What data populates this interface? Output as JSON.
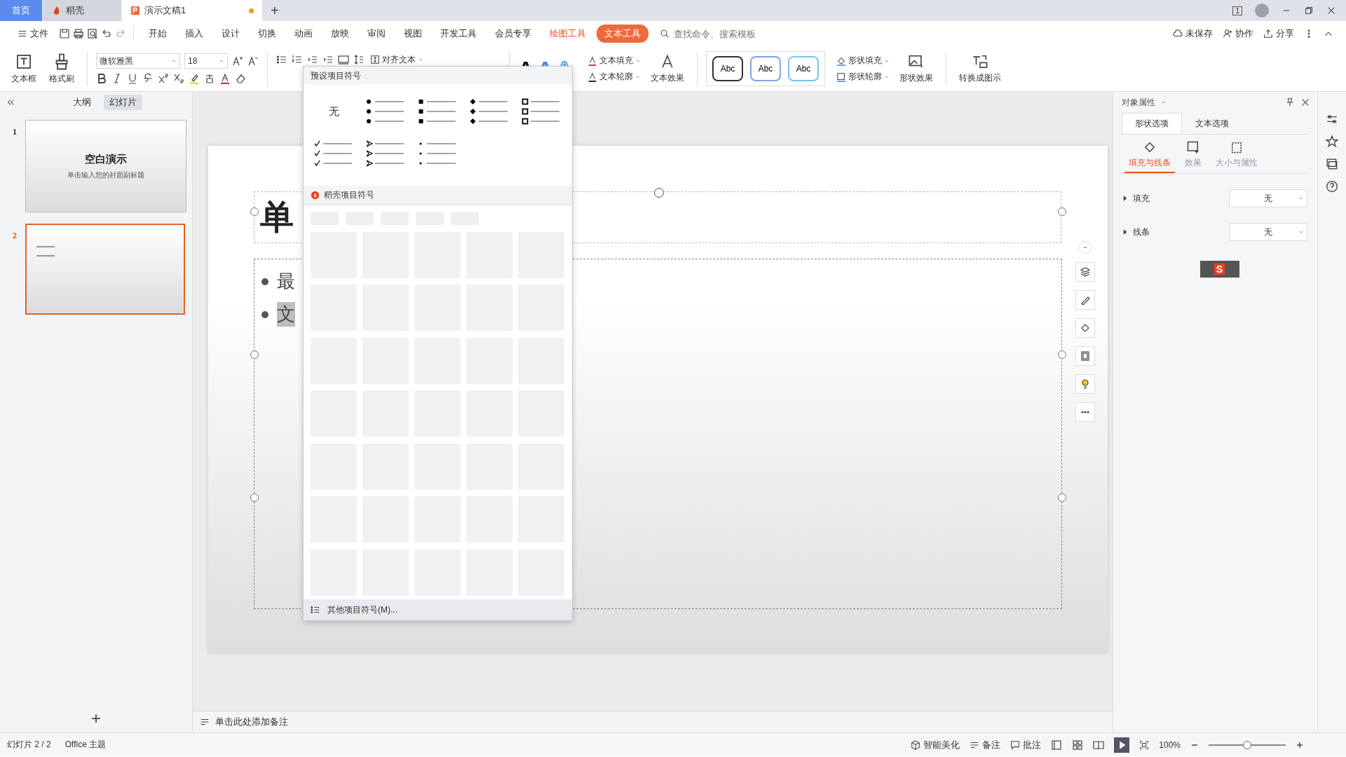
{
  "tabs": [
    {
      "label": "首页",
      "kind": "home",
      "selected": false
    },
    {
      "label": "稻壳",
      "kind": "docer",
      "selected": false
    },
    {
      "label": "演示文稿1",
      "kind": "doc",
      "selected": true,
      "unsaved": true
    }
  ],
  "new_tab": "+",
  "window_count": "1",
  "menu": {
    "file": "文件",
    "items": [
      {
        "label": "开始",
        "kind": "plain"
      },
      {
        "label": "插入",
        "kind": "plain"
      },
      {
        "label": "设计",
        "kind": "plain"
      },
      {
        "label": "切换",
        "kind": "plain"
      },
      {
        "label": "动画",
        "kind": "plain"
      },
      {
        "label": "放映",
        "kind": "plain"
      },
      {
        "label": "审阅",
        "kind": "plain"
      },
      {
        "label": "视图",
        "kind": "plain"
      },
      {
        "label": "开发工具",
        "kind": "plain"
      },
      {
        "label": "会员专享",
        "kind": "plain"
      },
      {
        "label": "绘图工具",
        "kind": "context",
        "selected": false
      },
      {
        "label": "文本工具",
        "kind": "context",
        "selected": true
      }
    ],
    "search": {
      "placeholder": "查找命令、搜索模板"
    },
    "actions": [
      "未保存",
      "协作",
      "分享"
    ]
  },
  "ribbon": {
    "textbox": "文本框",
    "format_painter": "格式刷",
    "font": "微软雅黑",
    "size": "18",
    "align": "对齐文本",
    "text_fill": "文本填充",
    "text_outline": "文本轮廓",
    "text_effect": "文本效果",
    "style_samples": [
      "Abc",
      "Abc",
      "Abc"
    ],
    "shape_fill": "形状填充",
    "shape_outline": "形状轮廓",
    "shape_effect": "形状效果",
    "convert": "转换成图示"
  },
  "left_panel": {
    "views": [
      {
        "label": "大纲",
        "selected": false
      },
      {
        "label": "幻灯片",
        "selected": true
      }
    ],
    "slides": [
      {
        "number": "1",
        "title": "空白演示",
        "subtitle": "单击输入您的封面副标题",
        "selected": false
      },
      {
        "number": "2",
        "selected": true
      }
    ],
    "add": "+"
  },
  "slide": {
    "title": "单",
    "bullets": [
      {
        "text": "最",
        "selected": false
      },
      {
        "text": "文",
        "selected": true
      }
    ]
  },
  "bullet_menu": {
    "header": "预设项目符号",
    "options": [
      {
        "kind": "none",
        "label": "无"
      },
      {
        "kind": "dot"
      },
      {
        "kind": "square"
      },
      {
        "kind": "diamond"
      },
      {
        "kind": "box"
      },
      {
        "kind": "check"
      },
      {
        "kind": "arrow"
      },
      {
        "kind": "small-dot"
      }
    ],
    "section": "稻壳项目符号",
    "footer": "其他项目符号(M)..."
  },
  "right_panel": {
    "title": "对象属性",
    "tabs": [
      {
        "label": "形状选项",
        "selected": true
      },
      {
        "label": "文本选项",
        "selected": false
      }
    ],
    "subtabs": [
      {
        "label": "填充与线条",
        "selected": true
      },
      {
        "label": "效果",
        "selected": false
      },
      {
        "label": "大小与属性",
        "selected": false
      }
    ],
    "props": [
      {
        "label": "填充",
        "value": "无"
      },
      {
        "label": "线条",
        "value": "无"
      }
    ],
    "ime_logo": "S"
  },
  "notes": {
    "placeholder": "单击此处添加备注"
  },
  "status_bar": {
    "slide": "幻灯片 2 / 2",
    "theme": "Office 主题",
    "beautify": "智能美化",
    "notes": "备注",
    "comments": "批注",
    "zoom": "100%",
    "zoom_level": {
      "level": 0.5
    }
  }
}
